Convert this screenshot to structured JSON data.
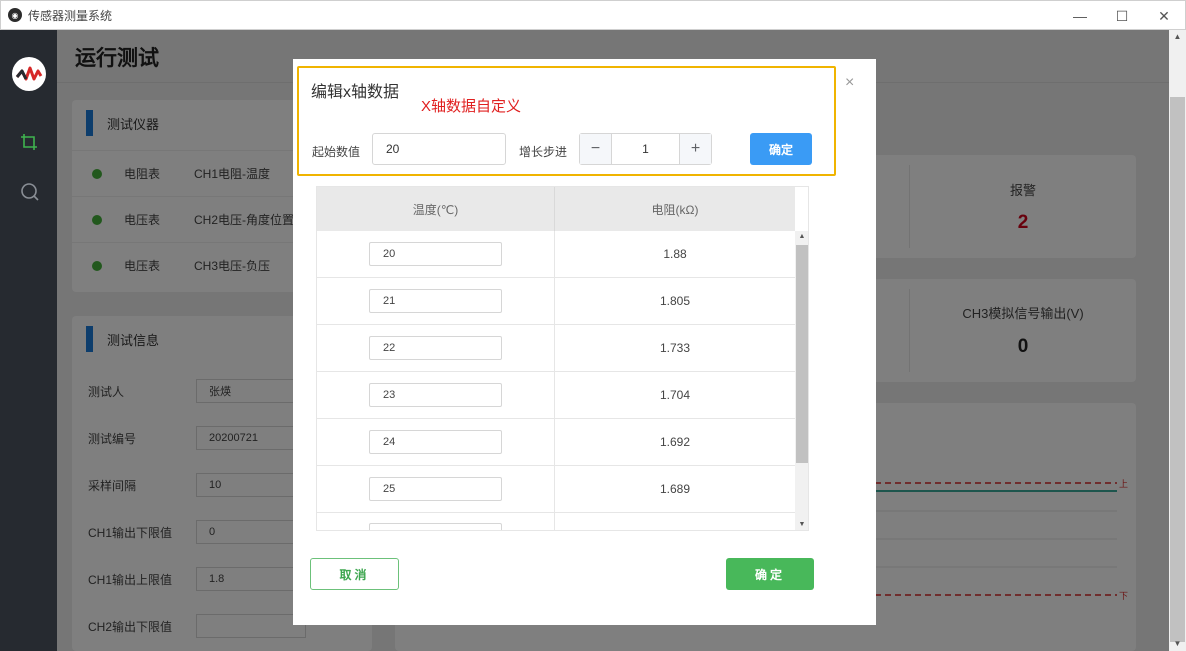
{
  "window": {
    "title": "传感器测量系统",
    "minimize": "—",
    "maximize": "☐",
    "close": "✕"
  },
  "page": {
    "title": "运行测试"
  },
  "instruments": {
    "heading": "测试仪器",
    "rows": [
      {
        "type": "电阻表",
        "channel": "CH1电阻-温度"
      },
      {
        "type": "电压表",
        "channel": "CH2电压-角度位置"
      },
      {
        "type": "电压表",
        "channel": "CH3电压-负压"
      }
    ]
  },
  "test_info": {
    "heading": "测试信息",
    "fields": [
      {
        "label": "测试人",
        "value": "张煐"
      },
      {
        "label": "测试编号",
        "value": "20200721"
      },
      {
        "label": "采样间隔",
        "value": "10"
      },
      {
        "label": "CH1输出下限值",
        "value": "0"
      },
      {
        "label": "CH1输出上限值",
        "value": "1.8"
      },
      {
        "label": "CH2输出下限值",
        "value": ""
      }
    ]
  },
  "stats": {
    "alarm_label": "报警",
    "alarm_value": "2",
    "ch3_label": "CH3模拟信号输出(V)",
    "ch3_value": "0"
  },
  "chart_marks": {
    "upper": "上",
    "lower": "下"
  },
  "modal": {
    "title": "编辑x轴数据",
    "annotation": "X轴数据自定义",
    "start_label": "起始数值",
    "start_value": "20",
    "step_label": "增长步进",
    "step_value": "1",
    "step_minus": "−",
    "step_plus": "+",
    "confirm_top": "确定",
    "close": "×",
    "table": {
      "headers": [
        "温度(℃)",
        "电阻(kΩ)"
      ],
      "rows": [
        {
          "temp": "20",
          "res": "1.88"
        },
        {
          "temp": "21",
          "res": "1.805"
        },
        {
          "temp": "22",
          "res": "1.733"
        },
        {
          "temp": "23",
          "res": "1.704"
        },
        {
          "temp": "24",
          "res": "1.692"
        },
        {
          "temp": "25",
          "res": "1.689"
        },
        {
          "temp": "",
          "res": ""
        }
      ]
    },
    "cancel": "取消",
    "confirm": "确定"
  },
  "colors": {
    "accent_blue": "#3a9bf5",
    "accent_green": "#48b85a",
    "annotation_border": "#f0b400",
    "annotation_text": "#e02020",
    "alarm": "#d0021b"
  }
}
